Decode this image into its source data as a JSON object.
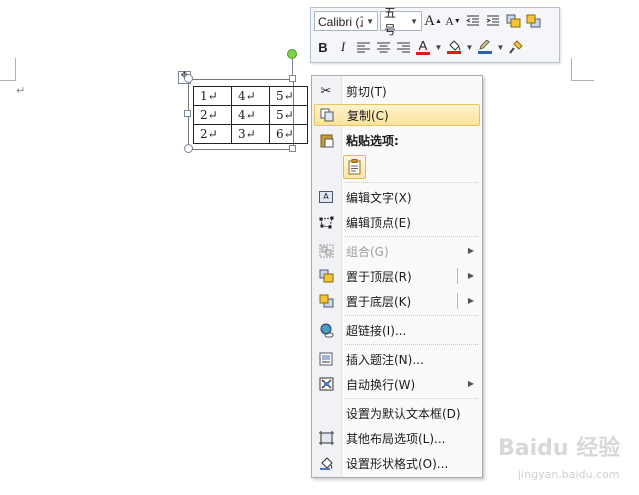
{
  "minibar": {
    "font_name": "Calibri (正",
    "font_size": "五号",
    "row1_buttons": [
      {
        "name": "grow-font-button",
        "glyph": "A"
      },
      {
        "name": "shrink-font-button",
        "glyph": "A"
      },
      {
        "name": "decrease-indent-button",
        "glyph": "⇤"
      },
      {
        "name": "increase-indent-button",
        "glyph": "⇥"
      },
      {
        "name": "bring-forward-button",
        "glyph": "▣"
      },
      {
        "name": "send-backward-button",
        "glyph": "▣"
      }
    ],
    "bold": "B",
    "italic": "I",
    "font_color_glyph": "A"
  },
  "paragraph_mark": "↵",
  "table": {
    "rows": [
      [
        "1↵",
        "4↵",
        "5↵"
      ],
      [
        "2↵",
        "4↵",
        "5↵"
      ],
      [
        "2↵",
        "3↵",
        "6↵"
      ]
    ]
  },
  "context_menu": {
    "cut": "剪切(T)",
    "copy": "复制(C)",
    "paste_header": "粘贴选项:",
    "edit_text": "编辑文字(X)",
    "edit_points": "编辑顶点(E)",
    "group": "组合(G)",
    "bring_to_front": "置于顶层(R)",
    "send_to_back": "置于底层(K)",
    "hyperlink": "超链接(I)...",
    "insert_caption": "插入题注(N)...",
    "wrap_text": "自动换行(W)",
    "set_default_textbox": "设置为默认文本框(D)",
    "more_layout": "其他布局选项(L)...",
    "format_shape": "设置形状格式(O)..."
  },
  "watermark": {
    "logo": "Baidu 经验",
    "url": "jingyan.baidu.com"
  }
}
